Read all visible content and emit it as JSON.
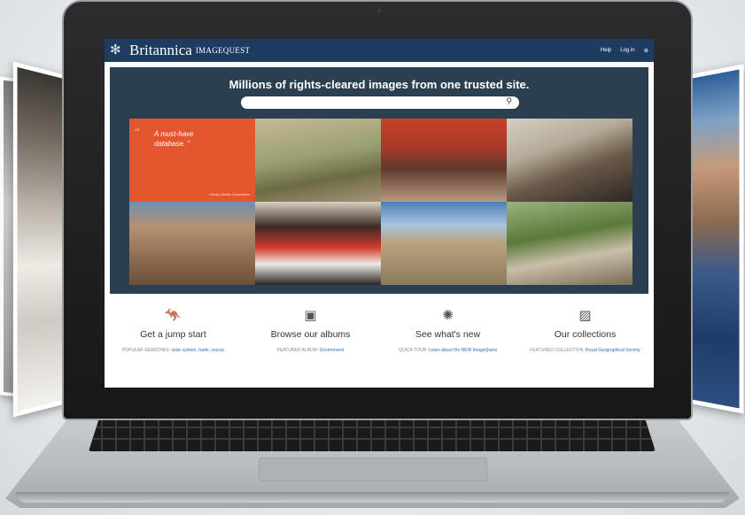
{
  "app": {
    "brand": "Britannica",
    "product": "IMAGEQUEST",
    "top_links": {
      "help": "Help",
      "login": "Log in"
    }
  },
  "hero": {
    "title": "Millions of rights-cleared images from one trusted site.",
    "search_placeholder": ""
  },
  "quote": {
    "open_mark": "“",
    "text": "A must-have database.",
    "close_mark": "”",
    "attribution": "Library Media Connection"
  },
  "features": [
    {
      "icon": "kangaroo-icon",
      "title": "Get a jump start",
      "prefix": "POPULAR SEARCHES:",
      "link": "solar system, trade, soccer"
    },
    {
      "icon": "album-icon",
      "title": "Browse our albums",
      "prefix": "FEATURED ALBUM:",
      "link": "Government"
    },
    {
      "icon": "sun-icon",
      "title": "See what's new",
      "prefix": "QUICK TOUR:",
      "link": "Learn about the NEW ImageQuest"
    },
    {
      "icon": "image-icon",
      "title": "Our collections",
      "prefix": "FEATURED COLLECTION:",
      "link": "Royal Geographical Society"
    }
  ],
  "colors": {
    "topbar": "#1d3c5f",
    "hero_bg": "#2c3f51",
    "quote_bg": "#e4572e",
    "link": "#2d6fb7"
  }
}
